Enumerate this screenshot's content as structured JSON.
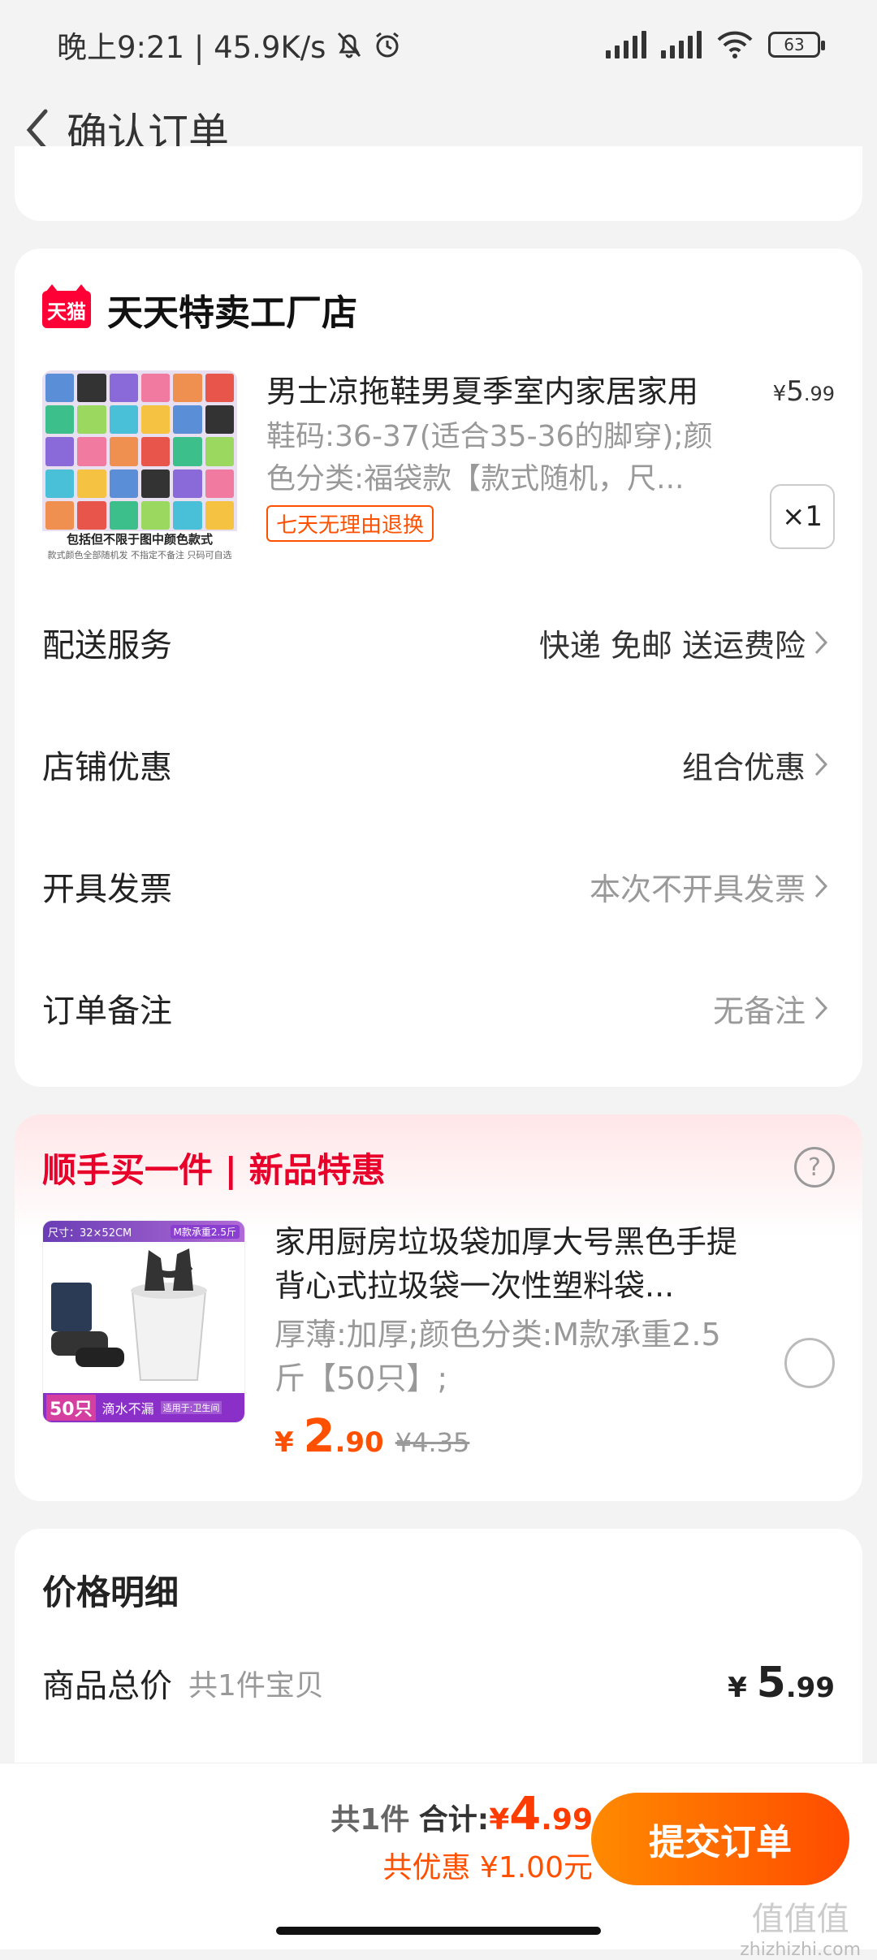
{
  "status_bar": {
    "time": "晚上9:21 | 45.9K/s",
    "battery": "63"
  },
  "nav": {
    "title": "确认订单"
  },
  "shop": {
    "name": "天天特卖工厂店",
    "badge": "天猫",
    "product": {
      "title": "男士凉拖鞋男夏季室内家居家用",
      "spec": "鞋码:36-37(适合35-36的脚穿);颜色分类:福袋款【款式随机，尺...",
      "tag": "七天无理由退换",
      "price_symbol": "¥",
      "price_int": "5",
      "price_dec": ".99",
      "qty": "×1",
      "image_caption_1": "包括但不限于图中颜色款式",
      "image_caption_2": "款式颜色全部随机发 不指定不备注 只码可自选"
    },
    "rows": [
      {
        "label": "配送服务",
        "value": "快递 免邮 送运费险",
        "muted": false
      },
      {
        "label": "店铺优惠",
        "value": "组合优惠",
        "muted": false
      },
      {
        "label": "开具发票",
        "value": "本次不开具发票",
        "muted": true
      },
      {
        "label": "订单备注",
        "value": "无备注",
        "muted": true
      }
    ]
  },
  "addon": {
    "title": "顺手买一件 | 新品特惠",
    "help": "?",
    "product": {
      "title": "家用厨房垃圾袋加厚大号黑色手提背心式拉圾袋一次性塑料袋...",
      "spec": "厚薄:加厚;颜色分类:M款承重2.5斤【50只】;",
      "price_symbol": "¥",
      "price_int": "2",
      "price_dec": ".90",
      "old_price": "¥4.35",
      "img_size": "尺寸：32×52CM",
      "img_weight": "M款承重2.5斤",
      "img_count": "50只",
      "img_slogan": "滴水不漏",
      "img_use": "适用于:卫生间"
    }
  },
  "price_detail": {
    "title": "价格明细",
    "label": "商品总价",
    "sub": "共1件宝贝",
    "amount_symbol": "¥",
    "amount_int": "5",
    "amount_dec": ".99"
  },
  "bottom": {
    "count": "共1件",
    "total_label": "合计:",
    "total_symbol": "¥",
    "total_int": "4",
    "total_dec": ".99",
    "discount": "共优惠 ¥1.00元",
    "submit": "提交订单"
  },
  "watermark": {
    "line1": "值值值",
    "line2": "zhizhizhi.com"
  },
  "colors": {
    "accent": "#ff5000",
    "tmall_red": "#ff0036",
    "addon_red": "#e8002b"
  }
}
